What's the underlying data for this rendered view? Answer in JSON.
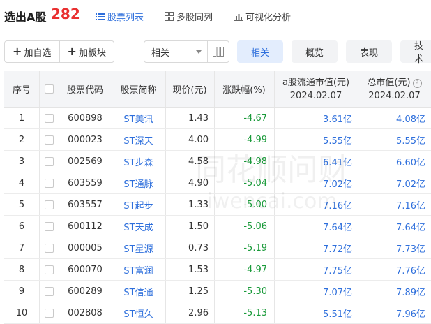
{
  "header": {
    "title": "选出A股",
    "count": "282",
    "view_tabs": [
      {
        "label": "股票列表",
        "icon": "list-icon",
        "active": true
      },
      {
        "label": "多股同列",
        "icon": "grid-icon",
        "active": false
      },
      {
        "label": "可视化分析",
        "icon": "bar-chart-icon",
        "active": false
      }
    ]
  },
  "toolbar": {
    "add_watchlist": "加自选",
    "add_sector": "加板块",
    "sort_select": "相关",
    "segments": [
      "相关",
      "概览",
      "表现",
      "技术"
    ],
    "active_segment": "相关"
  },
  "table": {
    "columns": {
      "index": "序号",
      "code": "股票代码",
      "name": "股票简称",
      "price": "现价(元)",
      "change": "涨跌幅(%)",
      "float_cap": "a股流通市值(元)",
      "float_cap_date": "2024.02.07",
      "total_cap": "总市值(元)",
      "total_cap_date": "2024.02.07"
    },
    "rows": [
      {
        "idx": "1",
        "code": "600898",
        "name": "ST美讯",
        "price": "1.43",
        "change": "-4.67",
        "float_cap": "3.61亿",
        "total_cap": "4.08亿"
      },
      {
        "idx": "2",
        "code": "000023",
        "name": "ST深天",
        "price": "4.00",
        "change": "-4.99",
        "float_cap": "5.55亿",
        "total_cap": "5.55亿"
      },
      {
        "idx": "3",
        "code": "002569",
        "name": "ST步森",
        "price": "4.58",
        "change": "-4.98",
        "float_cap": "6.41亿",
        "total_cap": "6.60亿"
      },
      {
        "idx": "4",
        "code": "603559",
        "name": "ST通脉",
        "price": "4.90",
        "change": "-5.04",
        "float_cap": "7.02亿",
        "total_cap": "7.02亿"
      },
      {
        "idx": "5",
        "code": "603557",
        "name": "ST起步",
        "price": "1.33",
        "change": "-5.00",
        "float_cap": "7.16亿",
        "total_cap": "7.16亿"
      },
      {
        "idx": "6",
        "code": "600112",
        "name": "ST天成",
        "price": "1.50",
        "change": "-5.06",
        "float_cap": "7.64亿",
        "total_cap": "7.64亿"
      },
      {
        "idx": "7",
        "code": "000005",
        "name": "ST星源",
        "price": "0.73",
        "change": "-5.19",
        "float_cap": "7.72亿",
        "total_cap": "7.73亿"
      },
      {
        "idx": "8",
        "code": "600070",
        "name": "ST富润",
        "price": "1.53",
        "change": "-4.97",
        "float_cap": "7.75亿",
        "total_cap": "7.76亿"
      },
      {
        "idx": "9",
        "code": "600289",
        "name": "ST信通",
        "price": "1.25",
        "change": "-5.30",
        "float_cap": "7.07亿",
        "total_cap": "7.89亿"
      },
      {
        "idx": "10",
        "code": "002808",
        "name": "ST恒久",
        "price": "2.96",
        "change": "-5.13",
        "float_cap": "5.51亿",
        "total_cap": "7.96亿"
      }
    ]
  },
  "watermark": {
    "line1": "同花顺问财",
    "line2": "iwencai.com"
  },
  "colors": {
    "accent": "#2e6fdc",
    "count_red": "#e93030",
    "down_green": "#1a9a3a"
  }
}
